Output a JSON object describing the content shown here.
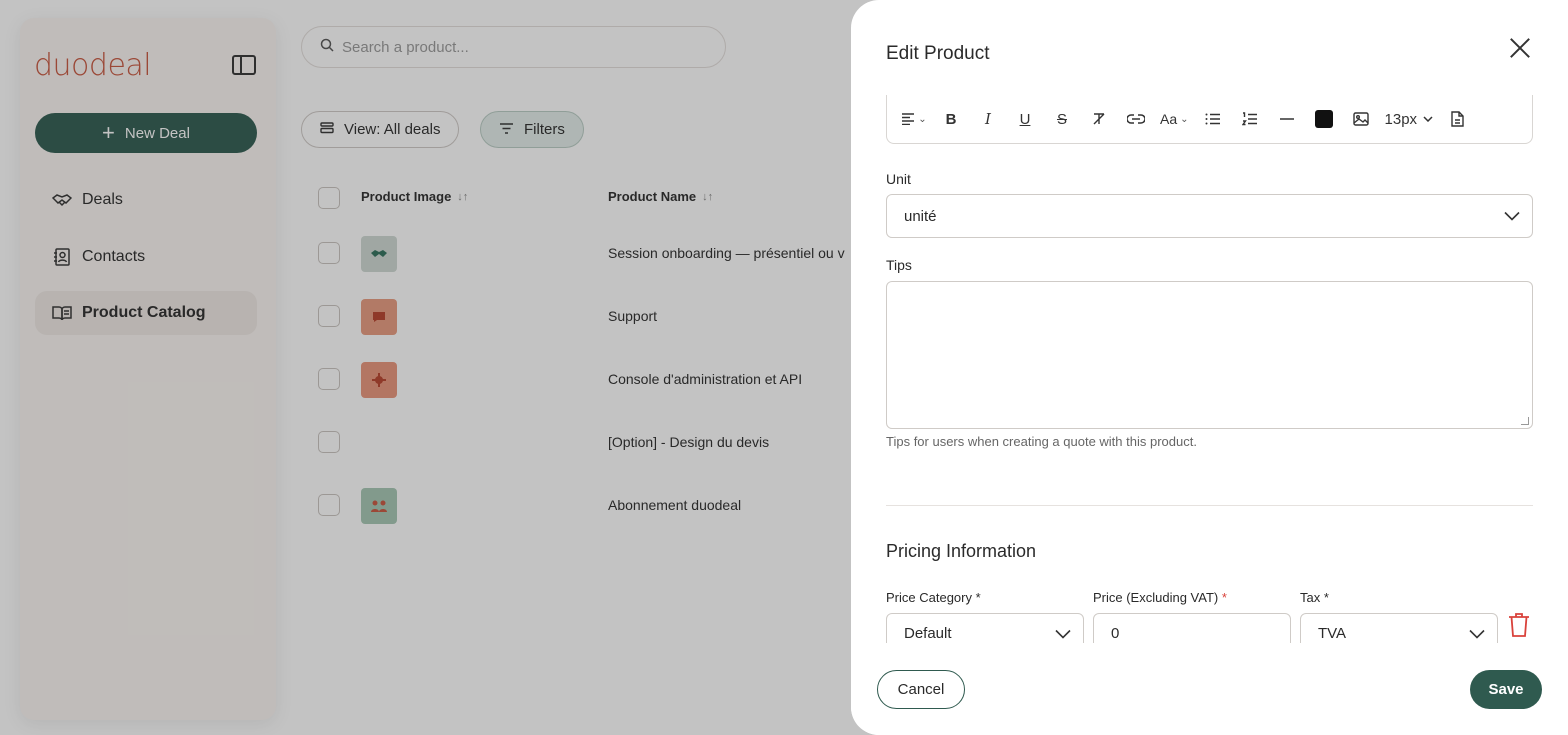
{
  "sidebar": {
    "logo": "duodeal",
    "new_deal_label": "New Deal",
    "items": [
      {
        "label": "Deals",
        "icon": "handshake-icon"
      },
      {
        "label": "Contacts",
        "icon": "contact-book-icon"
      },
      {
        "label": "Product Catalog",
        "icon": "open-book-icon",
        "active": true
      }
    ]
  },
  "search": {
    "placeholder": "Search a product..."
  },
  "toolbar": {
    "view_label": "View: All deals",
    "filters_label": "Filters"
  },
  "table": {
    "columns": [
      "Product Image",
      "Product Name"
    ],
    "rows": [
      {
        "name": "Session onboarding — présentiel ou v",
        "thumb_color": "#cfd8d3",
        "thumb_icon": "handshake-icon"
      },
      {
        "name": "Support",
        "thumb_color": "#e89a7e",
        "thumb_icon": "chat-icon"
      },
      {
        "name": "Console d'administration et API",
        "thumb_color": "#e9957a",
        "thumb_icon": "gear-icon"
      },
      {
        "name": "[Option] - Design du devis",
        "thumb_color": "",
        "thumb_icon": ""
      },
      {
        "name": "Abonnement duodeal",
        "thumb_color": "#a6c7b3",
        "thumb_icon": "people-icon"
      }
    ]
  },
  "drawer": {
    "title": "Edit Product",
    "editor": {
      "font_size": "13px",
      "text_color": "#111111"
    },
    "unit": {
      "label": "Unit",
      "value": "unité"
    },
    "tips": {
      "label": "Tips",
      "value": "",
      "hint": "Tips for users when creating a quote with this product."
    },
    "pricing": {
      "title": "Pricing Information",
      "category": {
        "label": "Price Category *",
        "value": "Default"
      },
      "price": {
        "label": "Price (Excluding VAT)",
        "required_mark": "*",
        "value": "0"
      },
      "tax": {
        "label": "Tax *",
        "value": "TVA"
      }
    },
    "cancel_label": "Cancel",
    "save_label": "Save"
  },
  "colors": {
    "brand": "#c8553d",
    "accent": "#2f5a4f",
    "danger": "#d9423b"
  }
}
